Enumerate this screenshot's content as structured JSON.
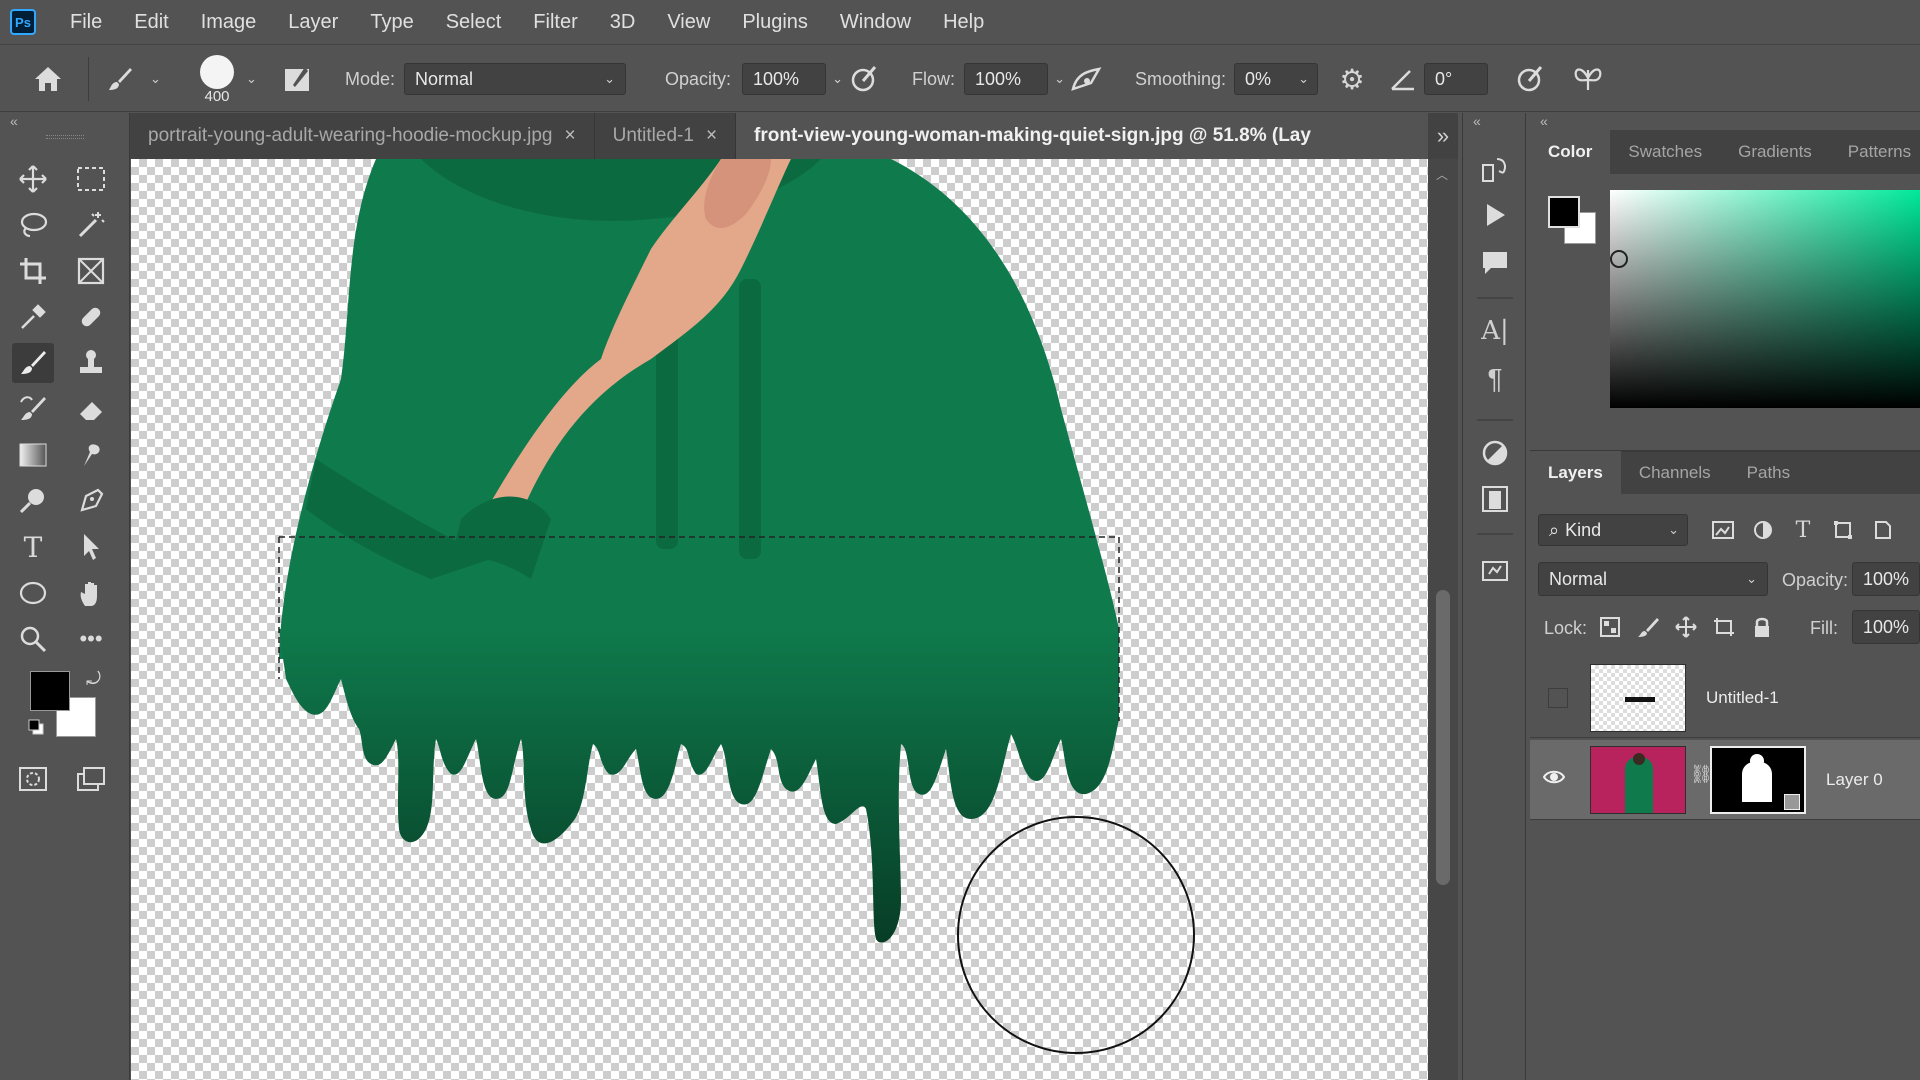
{
  "app": {
    "logo": "Ps"
  },
  "menu": [
    "File",
    "Edit",
    "Image",
    "Layer",
    "Type",
    "Select",
    "Filter",
    "3D",
    "View",
    "Plugins",
    "Window",
    "Help"
  ],
  "options": {
    "brush_size": "400",
    "mode_label": "Mode:",
    "mode_value": "Normal",
    "opacity_label": "Opacity:",
    "opacity_value": "100%",
    "flow_label": "Flow:",
    "flow_value": "100%",
    "smoothing_label": "Smoothing:",
    "smoothing_value": "0%",
    "angle_value": "0°"
  },
  "tabs": [
    {
      "label": "portrait-young-adult-wearing-hoodie-mockup.jpg",
      "close": "×"
    },
    {
      "label": "Untitled-1",
      "close": "×"
    },
    {
      "label": "front-view-young-woman-making-quiet-sign.jpg @ 51.8% (Lay"
    }
  ],
  "tab_overflow": "»",
  "color_panel": {
    "tabs": [
      "Color",
      "Swatches",
      "Gradients",
      "Patterns"
    ],
    "foreground": "#000000",
    "background": "#ffffff",
    "hue": "#00e89a"
  },
  "layers_panel": {
    "tabs": [
      "Layers",
      "Channels",
      "Paths"
    ],
    "filter_kind": "Kind",
    "blend_mode": "Normal",
    "opacity_label": "Opacity:",
    "opacity_value": "100%",
    "lock_label": "Lock:",
    "fill_label": "Fill:",
    "fill_value": "100%",
    "layers": [
      {
        "name": "Untitled-1",
        "visible": false
      },
      {
        "name": "Layer 0",
        "visible": true
      }
    ]
  },
  "colors": {
    "hoodie": "#0f7a4c",
    "hoodie_dark": "#0a5535",
    "skin": "#e3a78a"
  }
}
